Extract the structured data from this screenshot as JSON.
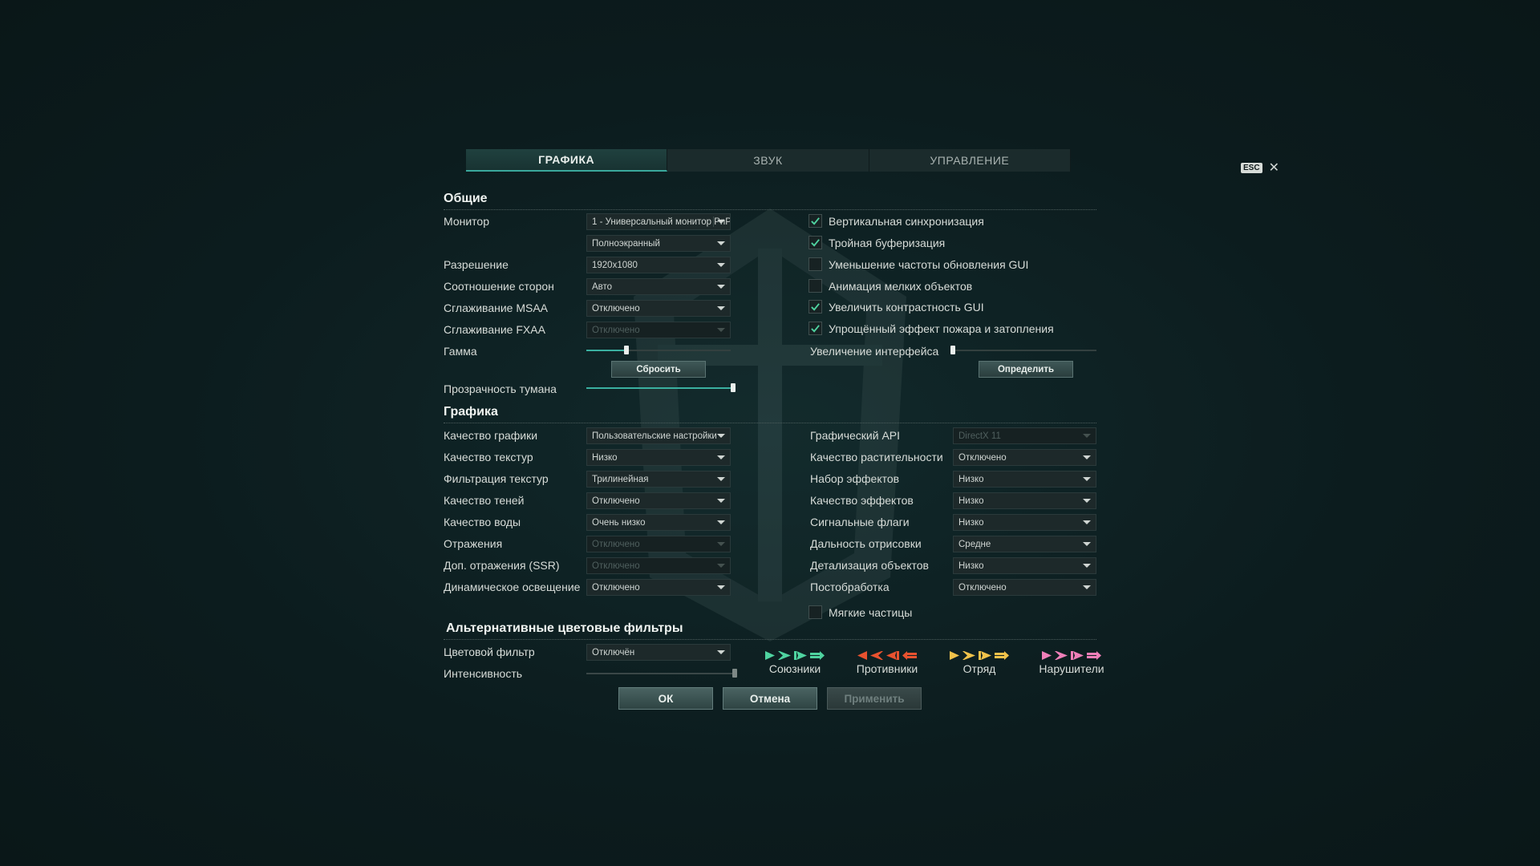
{
  "tabs": [
    {
      "label": "ГРАФИКА",
      "active": true
    },
    {
      "label": "ЗВУК",
      "active": false
    },
    {
      "label": "УПРАВЛЕНИЕ",
      "active": false
    }
  ],
  "esc": {
    "key": "ESC",
    "close": "✕"
  },
  "general": {
    "title": "Общие",
    "monitor_label": "Монитор",
    "monitor_value": "1 - Универсальный монитор PnP",
    "mode_value": "Полноэкранный",
    "resolution_label": "Разрешение",
    "resolution_value": "1920x1080",
    "aspect_label": "Соотношение сторон",
    "aspect_value": "Авто",
    "msaa_label": "Сглаживание MSAA",
    "msaa_value": "Отключено",
    "fxaa_label": "Сглаживание FXAA",
    "fxaa_value": "Отключено",
    "gamma_label": "Гамма",
    "gamma_level": 0.28,
    "reset_button": "Сбросить",
    "fog_label": "Прозрачность тумана",
    "fog_level": 1.0,
    "checks": [
      {
        "label": "Вертикальная синхронизация",
        "checked": true
      },
      {
        "label": "Тройная буферизация",
        "checked": true
      },
      {
        "label": "Уменьшение частоты обновления GUI",
        "checked": false
      },
      {
        "label": "Анимация мелких объектов",
        "checked": false
      },
      {
        "label": "Увеличить контрастность GUI",
        "checked": true
      },
      {
        "label": "Упрощённый эффект пожара и затопления",
        "checked": true
      }
    ],
    "ui_scale_label": "Увеличение интерфейса",
    "ui_scale_level": 0.0,
    "detect_button": "Определить"
  },
  "graphics": {
    "title": "Графика",
    "left": [
      {
        "label": "Качество графики",
        "value": "Пользовательские настройки",
        "disabled": false
      },
      {
        "label": "Качество текстур",
        "value": "Низко",
        "disabled": false
      },
      {
        "label": "Фильтрация текстур",
        "value": "Трилинейная",
        "disabled": false
      },
      {
        "label": "Качество теней",
        "value": "Отключено",
        "disabled": false
      },
      {
        "label": "Качество воды",
        "value": "Очень низко",
        "disabled": false
      },
      {
        "label": "Отражения",
        "value": "Отключено",
        "disabled": true
      },
      {
        "label": "Доп. отражения (SSR)",
        "value": "Отключено",
        "disabled": true
      },
      {
        "label": "Динамическое освещение",
        "value": "Отключено",
        "disabled": false
      }
    ],
    "right": [
      {
        "label": "Графический API",
        "value": "DirectX 11",
        "disabled": true
      },
      {
        "label": "Качество растительности",
        "value": "Отключено",
        "disabled": false
      },
      {
        "label": "Набор эффектов",
        "value": "Низко",
        "disabled": false
      },
      {
        "label": "Качество эффектов",
        "value": "Низко",
        "disabled": false
      },
      {
        "label": "Сигнальные флаги",
        "value": "Низко",
        "disabled": false
      },
      {
        "label": "Дальность отрисовки",
        "value": "Средне",
        "disabled": false
      },
      {
        "label": "Детализация объектов",
        "value": "Низко",
        "disabled": false
      },
      {
        "label": "Постобработка",
        "value": "Отключено",
        "disabled": false
      }
    ],
    "soft_particles_label": "Мягкие частицы",
    "soft_particles_checked": false
  },
  "filters": {
    "title": "Альтернативные цветовые фильтры",
    "filter_label": "Цветовой фильтр",
    "filter_value": "Отключён",
    "intensity_label": "Интенсивность",
    "intensity_level": 1.0,
    "groups": [
      {
        "name": "Союзники",
        "color": "#4fd3a0"
      },
      {
        "name": "Противники",
        "color": "#e8522f"
      },
      {
        "name": "Отряд",
        "color": "#f1c24a"
      },
      {
        "name": "Нарушители",
        "color": "#ef7fb8"
      }
    ]
  },
  "buttons": {
    "ok": "ОК",
    "cancel": "Отмена",
    "apply": "Применить"
  },
  "colors": {
    "accent": "#3ab0a0",
    "check": "#4fd3a0"
  }
}
